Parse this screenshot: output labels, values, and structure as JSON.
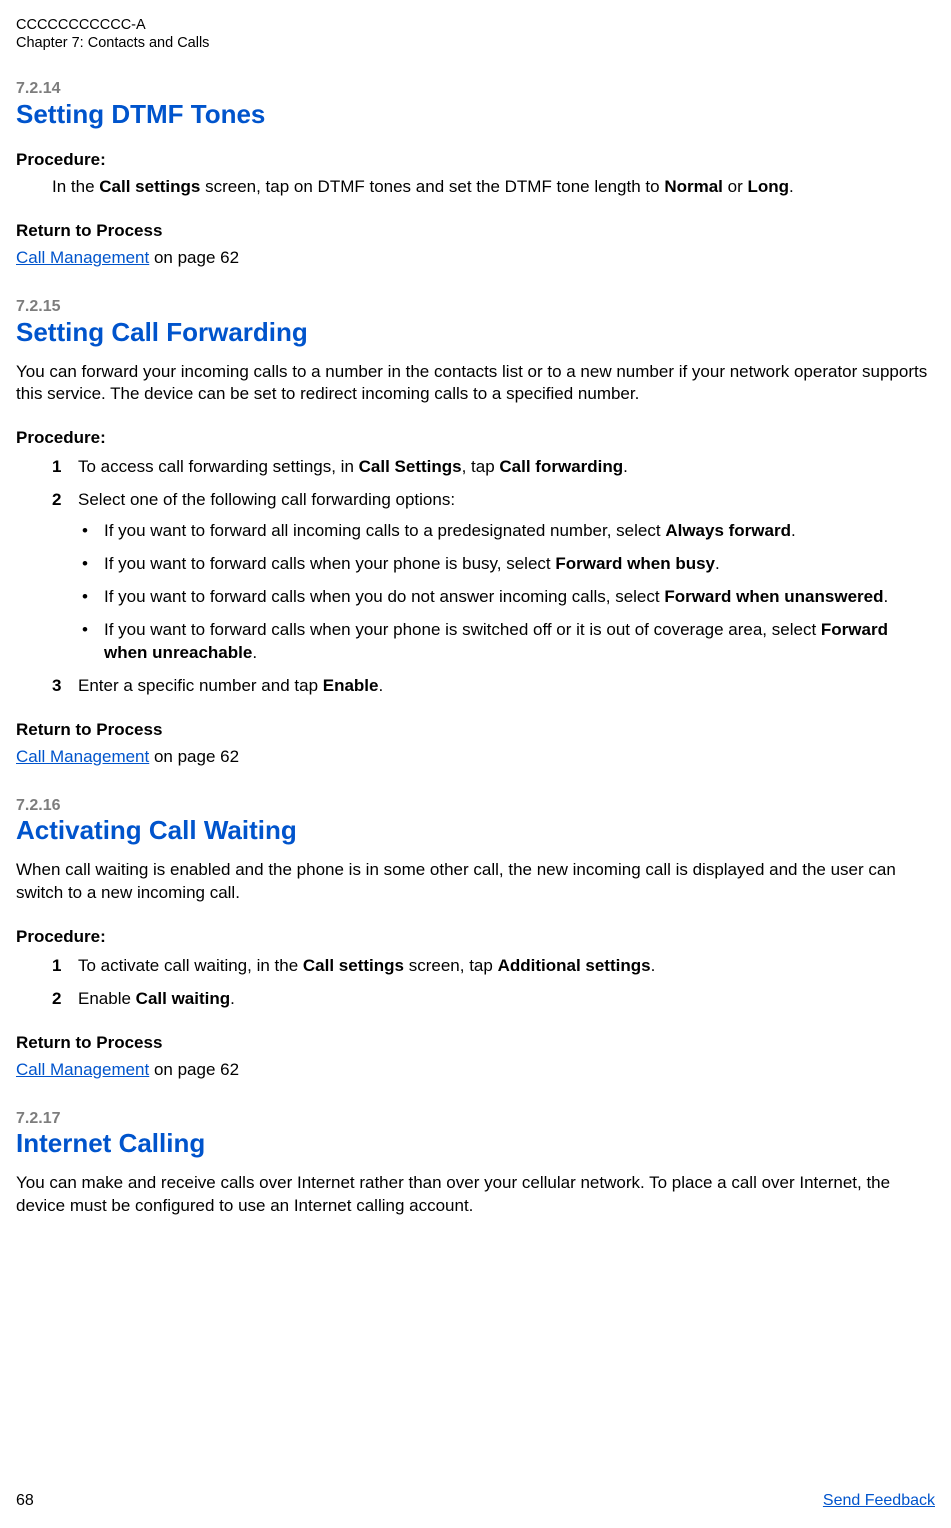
{
  "header": {
    "doc_id": "CCCCCCCCCCC-A",
    "chapter": "Chapter 7:  Contacts and Calls"
  },
  "sections": {
    "s1": {
      "num": "7.2.14",
      "title": "Setting DTMF Tones",
      "procedure_label": "Procedure:",
      "proc_text_a": "In the ",
      "proc_text_b": "Call settings",
      "proc_text_c": " screen, tap on DTMF tones and set the DTMF tone length to ",
      "proc_text_d": "Normal",
      "proc_text_e": " or ",
      "proc_text_f": "Long",
      "proc_text_g": ".",
      "rtp_label": "Return to Process",
      "rtp_link": "Call Management",
      "rtp_tail": " on page 62"
    },
    "s2": {
      "num": "7.2.15",
      "title": "Setting Call Forwarding",
      "intro": "You can forward your incoming calls to a number in the contacts list or to a new number if your network operator supports this service. The device can be set to redirect incoming calls to a specified number.",
      "procedure_label": "Procedure:",
      "step1_num": "1",
      "step1_a": "To access call forwarding settings, in ",
      "step1_b": "Call Settings",
      "step1_c": ", tap ",
      "step1_d": "Call forwarding",
      "step1_e": ".",
      "step2_num": "2",
      "step2_text": "Select one of the following call forwarding options:",
      "b1_a": "If you want to forward all incoming calls to a predesignated number, select ",
      "b1_b": "Always forward",
      "b1_c": ".",
      "b2_a": "If you want to forward calls when your phone is busy, select ",
      "b2_b": "Forward when busy",
      "b2_c": ".",
      "b3_a": "If you want to forward calls when you do not answer incoming calls, select ",
      "b3_b": "Forward when unanswered",
      "b3_c": ".",
      "b4_a": "If you want to forward calls when your phone is switched off or it is out of coverage area, select ",
      "b4_b": "Forward when unreachable",
      "b4_c": ".",
      "step3_num": "3",
      "step3_a": "Enter a specific number and tap ",
      "step3_b": "Enable",
      "step3_c": ".",
      "rtp_label": "Return to Process",
      "rtp_link": "Call Management",
      "rtp_tail": " on page 62"
    },
    "s3": {
      "num": "7.2.16",
      "title": "Activating Call Waiting",
      "intro": "When call waiting is enabled and the phone is in some other call, the new incoming call is displayed and the user can switch to a new incoming call.",
      "procedure_label": "Procedure:",
      "step1_num": "1",
      "step1_a": "To activate call waiting, in the ",
      "step1_b": "Call settings",
      "step1_c": " screen, tap ",
      "step1_d": "Additional settings",
      "step1_e": ".",
      "step2_num": "2",
      "step2_a": "Enable ",
      "step2_b": "Call waiting",
      "step2_c": ".",
      "rtp_label": "Return to Process",
      "rtp_link": "Call Management",
      "rtp_tail": " on page 62"
    },
    "s4": {
      "num": "7.2.17",
      "title": "Internet Calling",
      "intro": "You can make and receive calls over Internet rather than over your cellular network. To place a call over Internet, the device must be configured to use an Internet calling account."
    }
  },
  "footer": {
    "page_number": "68",
    "feedback": "Send Feedback"
  }
}
